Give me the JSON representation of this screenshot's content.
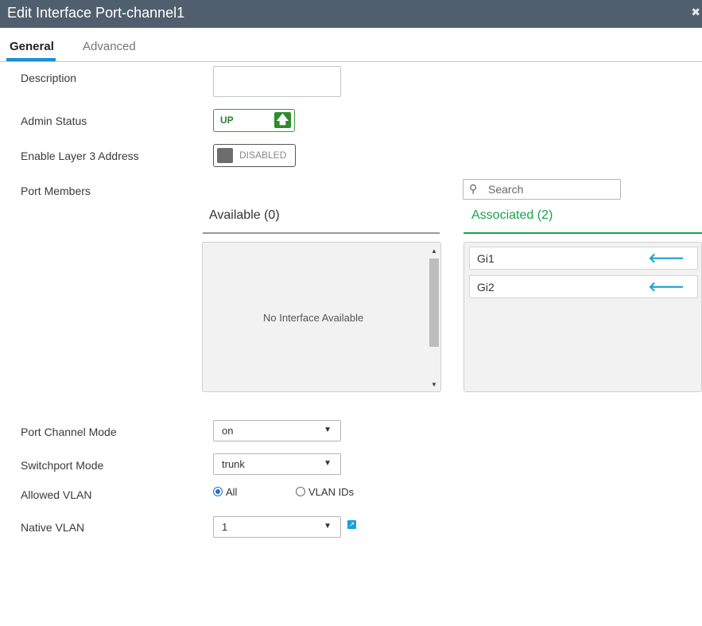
{
  "window": {
    "title": "Edit Interface Port-channel1",
    "close_icon": "close-icon"
  },
  "tabs": [
    {
      "label": "General",
      "active": true
    },
    {
      "label": "Advanced",
      "active": false
    }
  ],
  "form": {
    "description": {
      "label": "Description",
      "value": ""
    },
    "admin_status": {
      "label": "Admin Status",
      "value": "UP"
    },
    "layer3": {
      "label": "Enable Layer 3 Address",
      "value": "DISABLED"
    },
    "port_members": {
      "label": "Port Members",
      "search_placeholder": "Search",
      "available": {
        "heading": "Available (0)",
        "empty_message": "No Interface Available"
      },
      "associated": {
        "heading": "Associated (2)",
        "items": [
          "Gi1",
          "Gi2"
        ]
      }
    },
    "port_channel_mode": {
      "label": "Port Channel Mode",
      "value": "on"
    },
    "switchport_mode": {
      "label": "Switchport Mode",
      "value": "trunk"
    },
    "allowed_vlan": {
      "label": "Allowed VLAN",
      "options": [
        "All",
        "VLAN IDs"
      ],
      "selected": "All"
    },
    "native_vlan": {
      "label": "Native VLAN",
      "value": "1"
    }
  },
  "colors": {
    "titlebar": "#4f5f6e",
    "accent_blue": "#1a8fd1",
    "status_green": "#2e8b2e",
    "associated_green": "#19a34a"
  }
}
